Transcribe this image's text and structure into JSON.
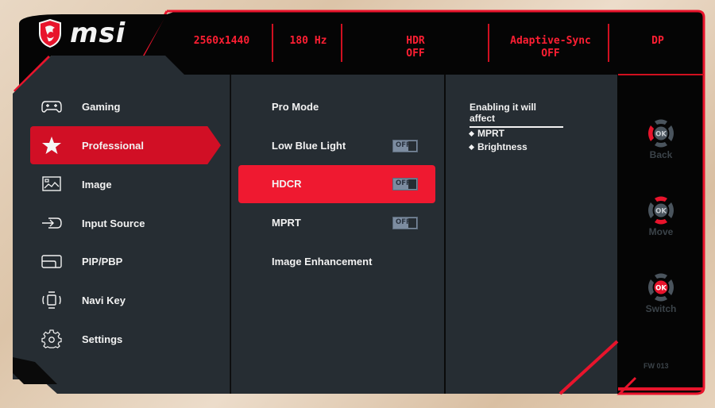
{
  "brand": {
    "name": "msi"
  },
  "status_bar": {
    "resolution": "2560x1440",
    "refresh_rate": "180 Hz",
    "hdr": {
      "label": "HDR",
      "value": "OFF"
    },
    "adaptive_sync": {
      "label": "Adaptive-Sync",
      "value": "OFF"
    },
    "input": "DP"
  },
  "sidebar": {
    "items": [
      {
        "label": "Gaming",
        "icon": "gamepad-icon",
        "active": false
      },
      {
        "label": "Professional",
        "icon": "star-icon",
        "active": true
      },
      {
        "label": "Image",
        "icon": "image-icon",
        "active": false
      },
      {
        "label": "Input Source",
        "icon": "input-source-icon",
        "active": false
      },
      {
        "label": "PIP/PBP",
        "icon": "pip-icon",
        "active": false
      },
      {
        "label": "Navi Key",
        "icon": "navi-key-icon",
        "active": false
      },
      {
        "label": "Settings",
        "icon": "gear-icon",
        "active": false
      }
    ]
  },
  "options": {
    "items": [
      {
        "label": "Pro Mode",
        "toggle": null,
        "active": false
      },
      {
        "label": "Low Blue Light",
        "toggle": "OFF",
        "active": false
      },
      {
        "label": "HDCR",
        "toggle": "OFF",
        "active": true
      },
      {
        "label": "MPRT",
        "toggle": "OFF",
        "active": false
      },
      {
        "label": "Image Enhancement",
        "toggle": null,
        "active": false
      }
    ]
  },
  "info": {
    "title": "Enabling it will affect",
    "items": [
      "MPRT",
      "Brightness"
    ]
  },
  "nav_hints": [
    {
      "label": "Back",
      "highlight": "left"
    },
    {
      "label": "Move",
      "highlight": "up-down"
    },
    {
      "label": "Switch",
      "highlight": "ok"
    }
  ],
  "nav_ok_label": "OK",
  "firmware": "FW 013",
  "colors": {
    "accent": "#e8142c",
    "panel": "#262d33",
    "frame": "#050505",
    "status_text": "#ff1f33"
  }
}
